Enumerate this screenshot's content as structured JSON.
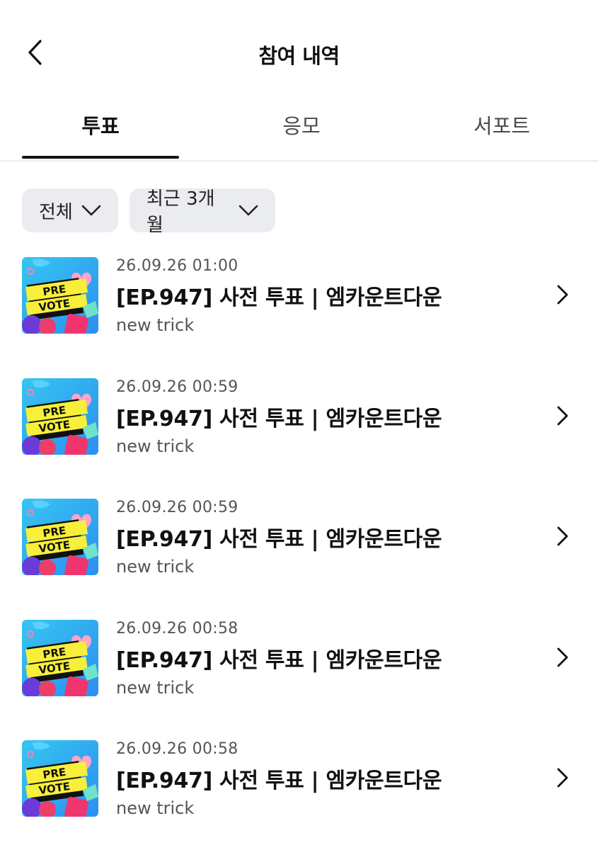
{
  "header": {
    "title": "참여 내역"
  },
  "tabs": [
    {
      "label": "투표",
      "active": true
    },
    {
      "label": "응모",
      "active": false
    },
    {
      "label": "서포트",
      "active": false
    }
  ],
  "filters": [
    {
      "label": "전체"
    },
    {
      "label": "최근 3개월"
    }
  ],
  "thumbnail_text": {
    "line1": "PRE",
    "line2": "VOTE"
  },
  "items": [
    {
      "date": "26.09.26 01:00",
      "title": "[EP.947] 사전 투표 | 엠카운트다운",
      "subtitle": "new trick"
    },
    {
      "date": "26.09.26 00:59",
      "title": "[EP.947] 사전 투표 | 엠카운트다운",
      "subtitle": "new trick"
    },
    {
      "date": "26.09.26 00:59",
      "title": "[EP.947] 사전 투표 | 엠카운트다운",
      "subtitle": "new trick"
    },
    {
      "date": "26.09.26 00:58",
      "title": "[EP.947] 사전 투표 | 엠카운트다운",
      "subtitle": "new trick"
    },
    {
      "date": "26.09.26 00:58",
      "title": "[EP.947] 사전 투표 | 엠카운트다운",
      "subtitle": "new trick"
    }
  ],
  "icons": {
    "back": "chevron-left-icon",
    "dropdown": "chevron-down-icon",
    "row": "chevron-right-icon"
  }
}
